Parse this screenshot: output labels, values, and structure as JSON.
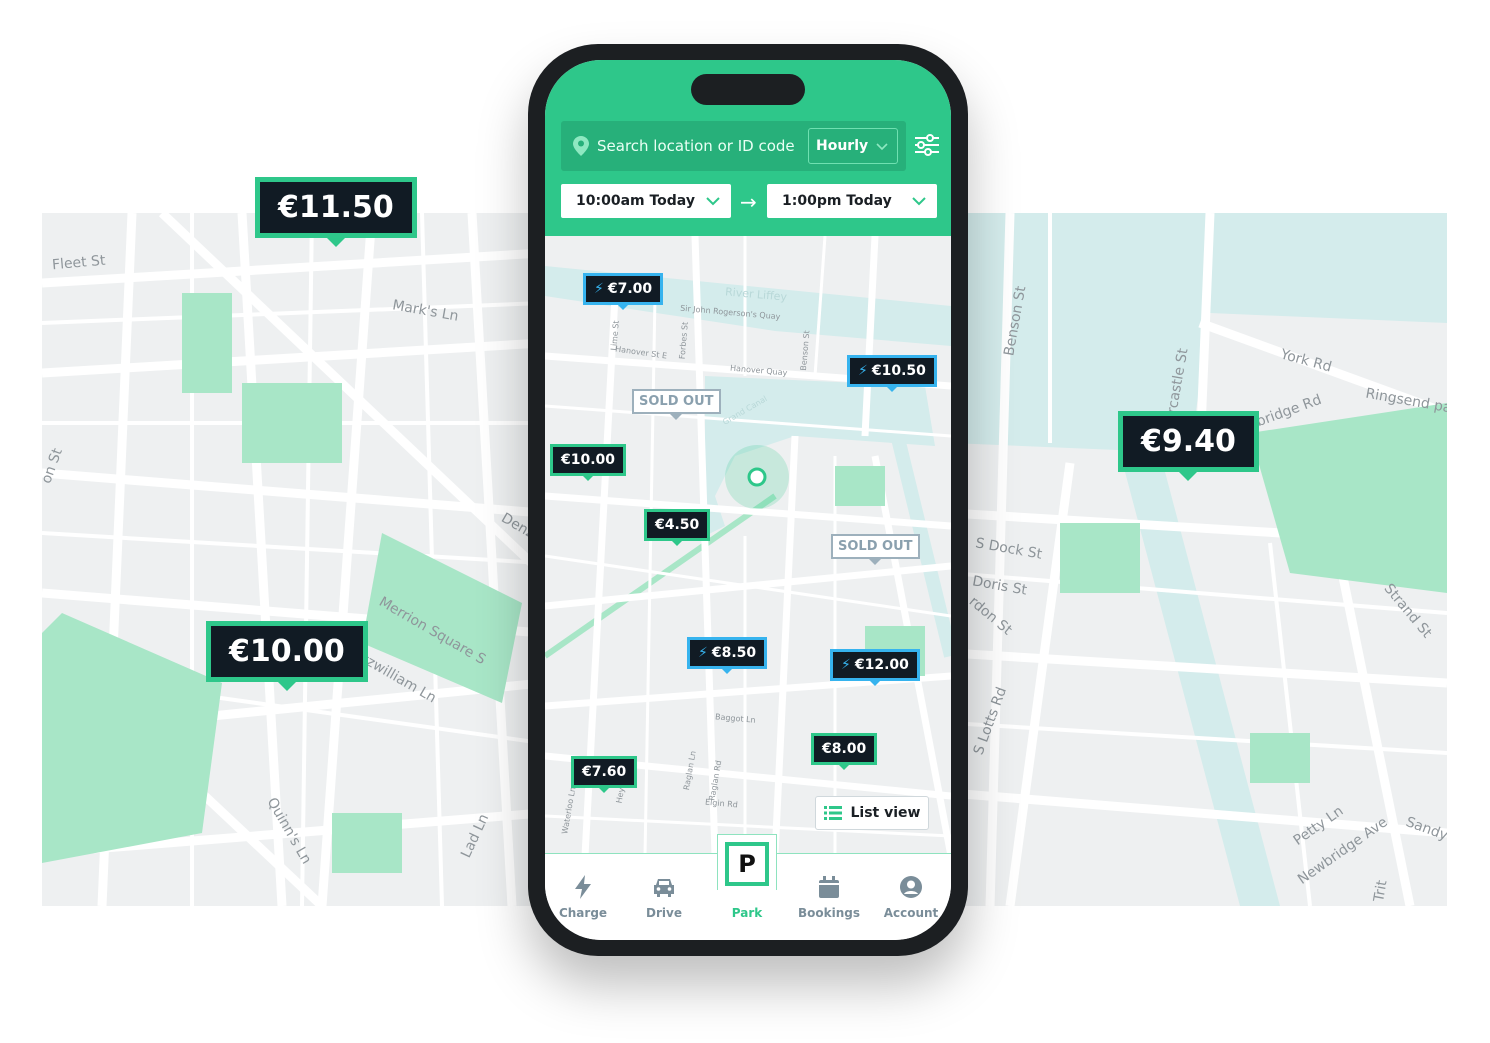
{
  "colors": {
    "brand": "#2ec78a",
    "ev": "#36b3ee",
    "marker_bg": "#111b24"
  },
  "background_map": {
    "left_markers": [
      "€11.50",
      "€10.00"
    ],
    "right_markers": [
      "€9.40"
    ],
    "left_labels": [
      "Fleet St",
      "Mark's Ln",
      "Merrion Square S",
      "Fitzwilliam Ln",
      "Quinn's Ln",
      "Lad Ln",
      "Denz",
      "on St"
    ],
    "right_labels": [
      "Benson St",
      "York Rd",
      "Ringsend pa",
      "bridge Rd",
      "rcastle St",
      "S Dock St",
      "Doris St",
      "rdon St",
      "S Lotts Rd",
      "Strand St",
      "Petty Ln",
      "Newbridge Ave",
      "Sandy",
      "Trit"
    ]
  },
  "header": {
    "search_placeholder": "Search location or ID code",
    "rate_select": "Hourly",
    "start_time": "10:00am Today",
    "end_time": "1:00pm Today"
  },
  "map": {
    "labels": [
      "River Liffey",
      "Sir John Rogerson's Quay",
      "Hanover St E",
      "Hanover Quay",
      "Forbes St",
      "Benson St",
      "Lime St",
      "Grand Canal",
      "Elgin Rd",
      "Raglan Ln",
      "Raglan Rd",
      "Baggot Ln",
      "Heytesbury",
      "Waterloo Ln"
    ],
    "markers": [
      {
        "type": "ev",
        "price": "€7.00"
      },
      {
        "type": "ev",
        "price": "€10.50"
      },
      {
        "type": "soldout",
        "price": "SOLD OUT"
      },
      {
        "type": "standard",
        "price": "€10.00"
      },
      {
        "type": "standard",
        "price": "€4.50"
      },
      {
        "type": "soldout",
        "price": "SOLD OUT"
      },
      {
        "type": "ev",
        "price": "€8.50"
      },
      {
        "type": "ev",
        "price": "€12.00"
      },
      {
        "type": "standard",
        "price": "€8.00"
      },
      {
        "type": "standard",
        "price": "€7.60"
      }
    ],
    "list_view": "List view"
  },
  "nav": {
    "items": [
      {
        "label": "Charge",
        "icon": "bolt-icon"
      },
      {
        "label": "Drive",
        "icon": "car-icon"
      },
      {
        "label": "Park",
        "icon": "parking-icon",
        "active": true,
        "glyph": "P"
      },
      {
        "label": "Bookings",
        "icon": "calendar-icon"
      },
      {
        "label": "Account",
        "icon": "user-icon"
      }
    ]
  }
}
